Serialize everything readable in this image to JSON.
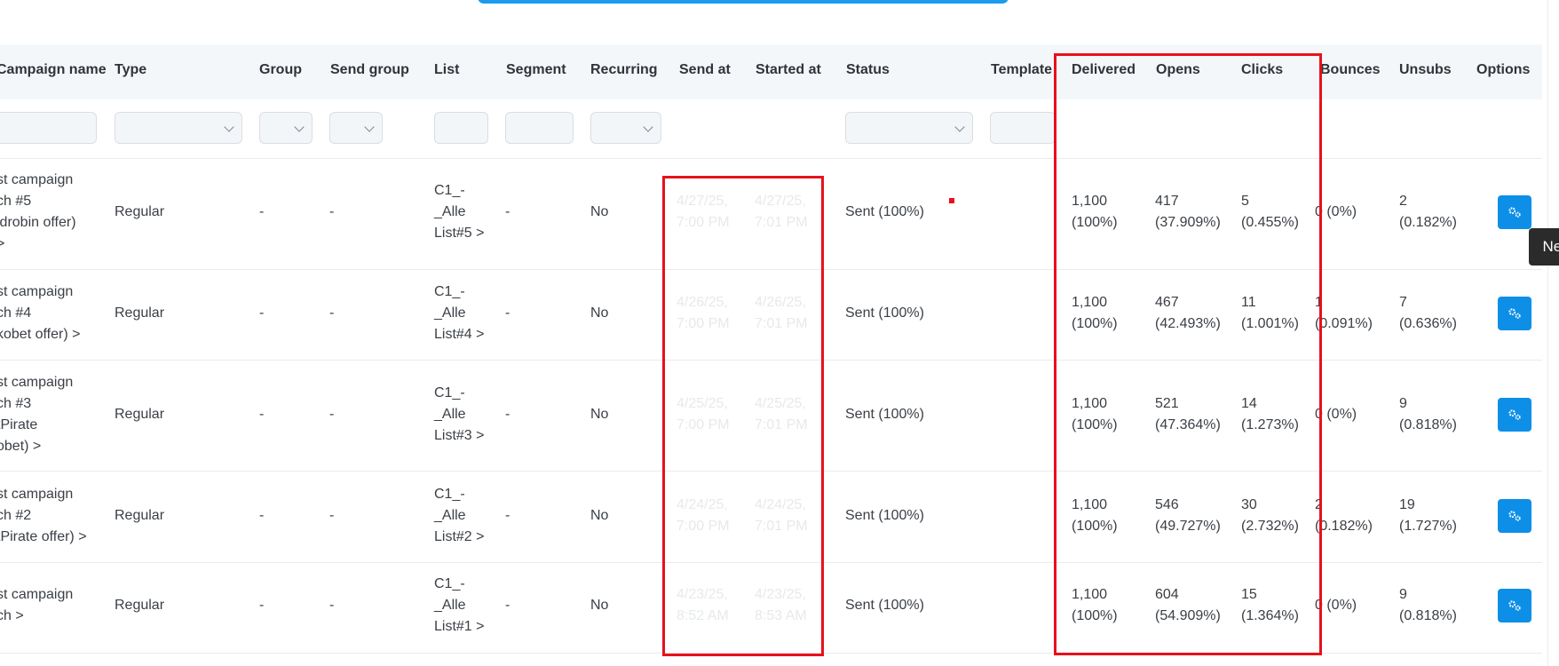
{
  "columns": [
    "Campaign name",
    "Type",
    "Group",
    "Send group",
    "List",
    "Segment",
    "Recurring",
    "Send at",
    "Started at",
    "Status",
    "Template",
    "Delivered",
    "Opens",
    "Clicks",
    "Bounces",
    "Unsubs",
    "Options"
  ],
  "rows": [
    {
      "name": [
        "st campaign",
        "ch #5",
        "ldrobin offer)",
        ">"
      ],
      "type": "Regular",
      "group": "-",
      "send_group": "-",
      "list": [
        "C1_-",
        "_Alle",
        "List#5 >"
      ],
      "segment": "-",
      "recurring": "No",
      "send_at": [
        "4/27/25,",
        "7:00 PM"
      ],
      "started_at": [
        "4/27/25,",
        "7:01 PM"
      ],
      "status": "Sent (100%)",
      "delivered": [
        "1,100",
        "(100%)"
      ],
      "opens": [
        "417",
        "(37.909%)"
      ],
      "clicks": [
        "5",
        "(0.455%)"
      ],
      "bounces": [
        "0 (0%)"
      ],
      "unsubs": [
        "2",
        "(0.182%)"
      ]
    },
    {
      "name": [
        "st campaign",
        "ch #4",
        "kobet offer) >"
      ],
      "type": "Regular",
      "group": "-",
      "send_group": "-",
      "list": [
        "C1_-",
        "_Alle",
        "List#4 >"
      ],
      "segment": "-",
      "recurring": "No",
      "send_at": [
        "4/26/25,",
        "7:00 PM"
      ],
      "started_at": [
        "4/26/25,",
        "7:01 PM"
      ],
      "status": "Sent (100%)",
      "delivered": [
        "1,100",
        "(100%)"
      ],
      "opens": [
        "467",
        "(42.493%)"
      ],
      "clicks": [
        "11",
        "(1.001%)"
      ],
      "bounces": [
        "1",
        "(0.091%)"
      ],
      "unsubs": [
        "7",
        "(0.636%)"
      ]
    },
    {
      "name": [
        "st campaign",
        "ch #3",
        "tPirate",
        "obet) >"
      ],
      "type": "Regular",
      "group": "-",
      "send_group": "-",
      "list": [
        "C1_-",
        "_Alle",
        "List#3 >"
      ],
      "segment": "-",
      "recurring": "No",
      "send_at": [
        "4/25/25,",
        "7:00 PM"
      ],
      "started_at": [
        "4/25/25,",
        "7:01 PM"
      ],
      "status": "Sent (100%)",
      "delivered": [
        "1,100",
        "(100%)"
      ],
      "opens": [
        "521",
        "(47.364%)"
      ],
      "clicks": [
        "14",
        "(1.273%)"
      ],
      "bounces": [
        "0 (0%)"
      ],
      "unsubs": [
        "9",
        "(0.818%)"
      ]
    },
    {
      "name": [
        "st campaign",
        "ch #2",
        "tPirate offer) >"
      ],
      "type": "Regular",
      "group": "-",
      "send_group": "-",
      "list": [
        "C1_-",
        "_Alle",
        "List#2 >"
      ],
      "segment": "-",
      "recurring": "No",
      "send_at": [
        "4/24/25,",
        "7:00 PM"
      ],
      "started_at": [
        "4/24/25,",
        "7:01 PM"
      ],
      "status": "Sent (100%)",
      "delivered": [
        "1,100",
        "(100%)"
      ],
      "opens": [
        "546",
        "(49.727%)"
      ],
      "clicks": [
        "30",
        "(2.732%)"
      ],
      "bounces": [
        "2",
        "(0.182%)"
      ],
      "unsubs": [
        "19",
        "(1.727%)"
      ]
    },
    {
      "name": [
        "st campaign",
        "ch >"
      ],
      "type": "Regular",
      "group": "-",
      "send_group": "-",
      "list": [
        "C1_-",
        "_Alle",
        "List#1 >"
      ],
      "segment": "-",
      "recurring": "No",
      "send_at": [
        "4/23/25,",
        "8:52 AM"
      ],
      "started_at": [
        "4/23/25,",
        "8:53 AM"
      ],
      "status": "Sent (100%)",
      "delivered": [
        "1,100",
        "(100%)"
      ],
      "opens": [
        "604",
        "(54.909%)"
      ],
      "clicks": [
        "15",
        "(1.364%)"
      ],
      "bounces": [
        "0 (0%)"
      ],
      "unsubs": [
        "9",
        "(0.818%)"
      ]
    }
  ],
  "tooltip": "Next",
  "colors": {
    "accent": "#0d8fe8",
    "highlight": "#e8101c",
    "header_bg": "#f4f7fa"
  },
  "icons": {
    "options": "gears-icon"
  }
}
